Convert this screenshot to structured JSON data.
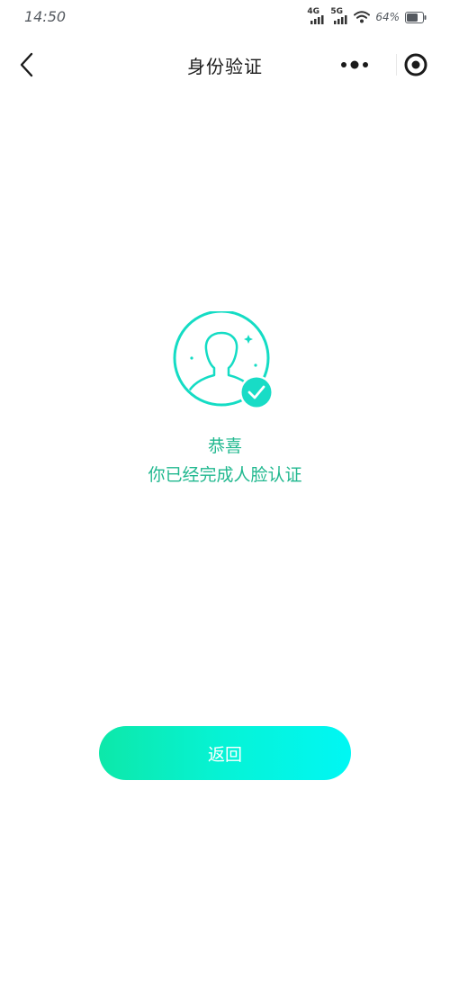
{
  "status_bar": {
    "time": "14:50",
    "network_1": "4G",
    "network_2": "5G",
    "battery": "64%"
  },
  "nav": {
    "title": "身份验证",
    "back_icon": "chevron-left-icon",
    "more_icon": "more-dots-icon",
    "close_icon": "target-circle-icon"
  },
  "result": {
    "icon": "verified-user-icon",
    "congrats": "恭喜",
    "message": "你已经完成人脸认证"
  },
  "actions": {
    "return_label": "返回"
  },
  "colors": {
    "accent": "#21b88f",
    "button_gradient_start": "#0de8a9",
    "button_gradient_end": "#00f7f4"
  }
}
